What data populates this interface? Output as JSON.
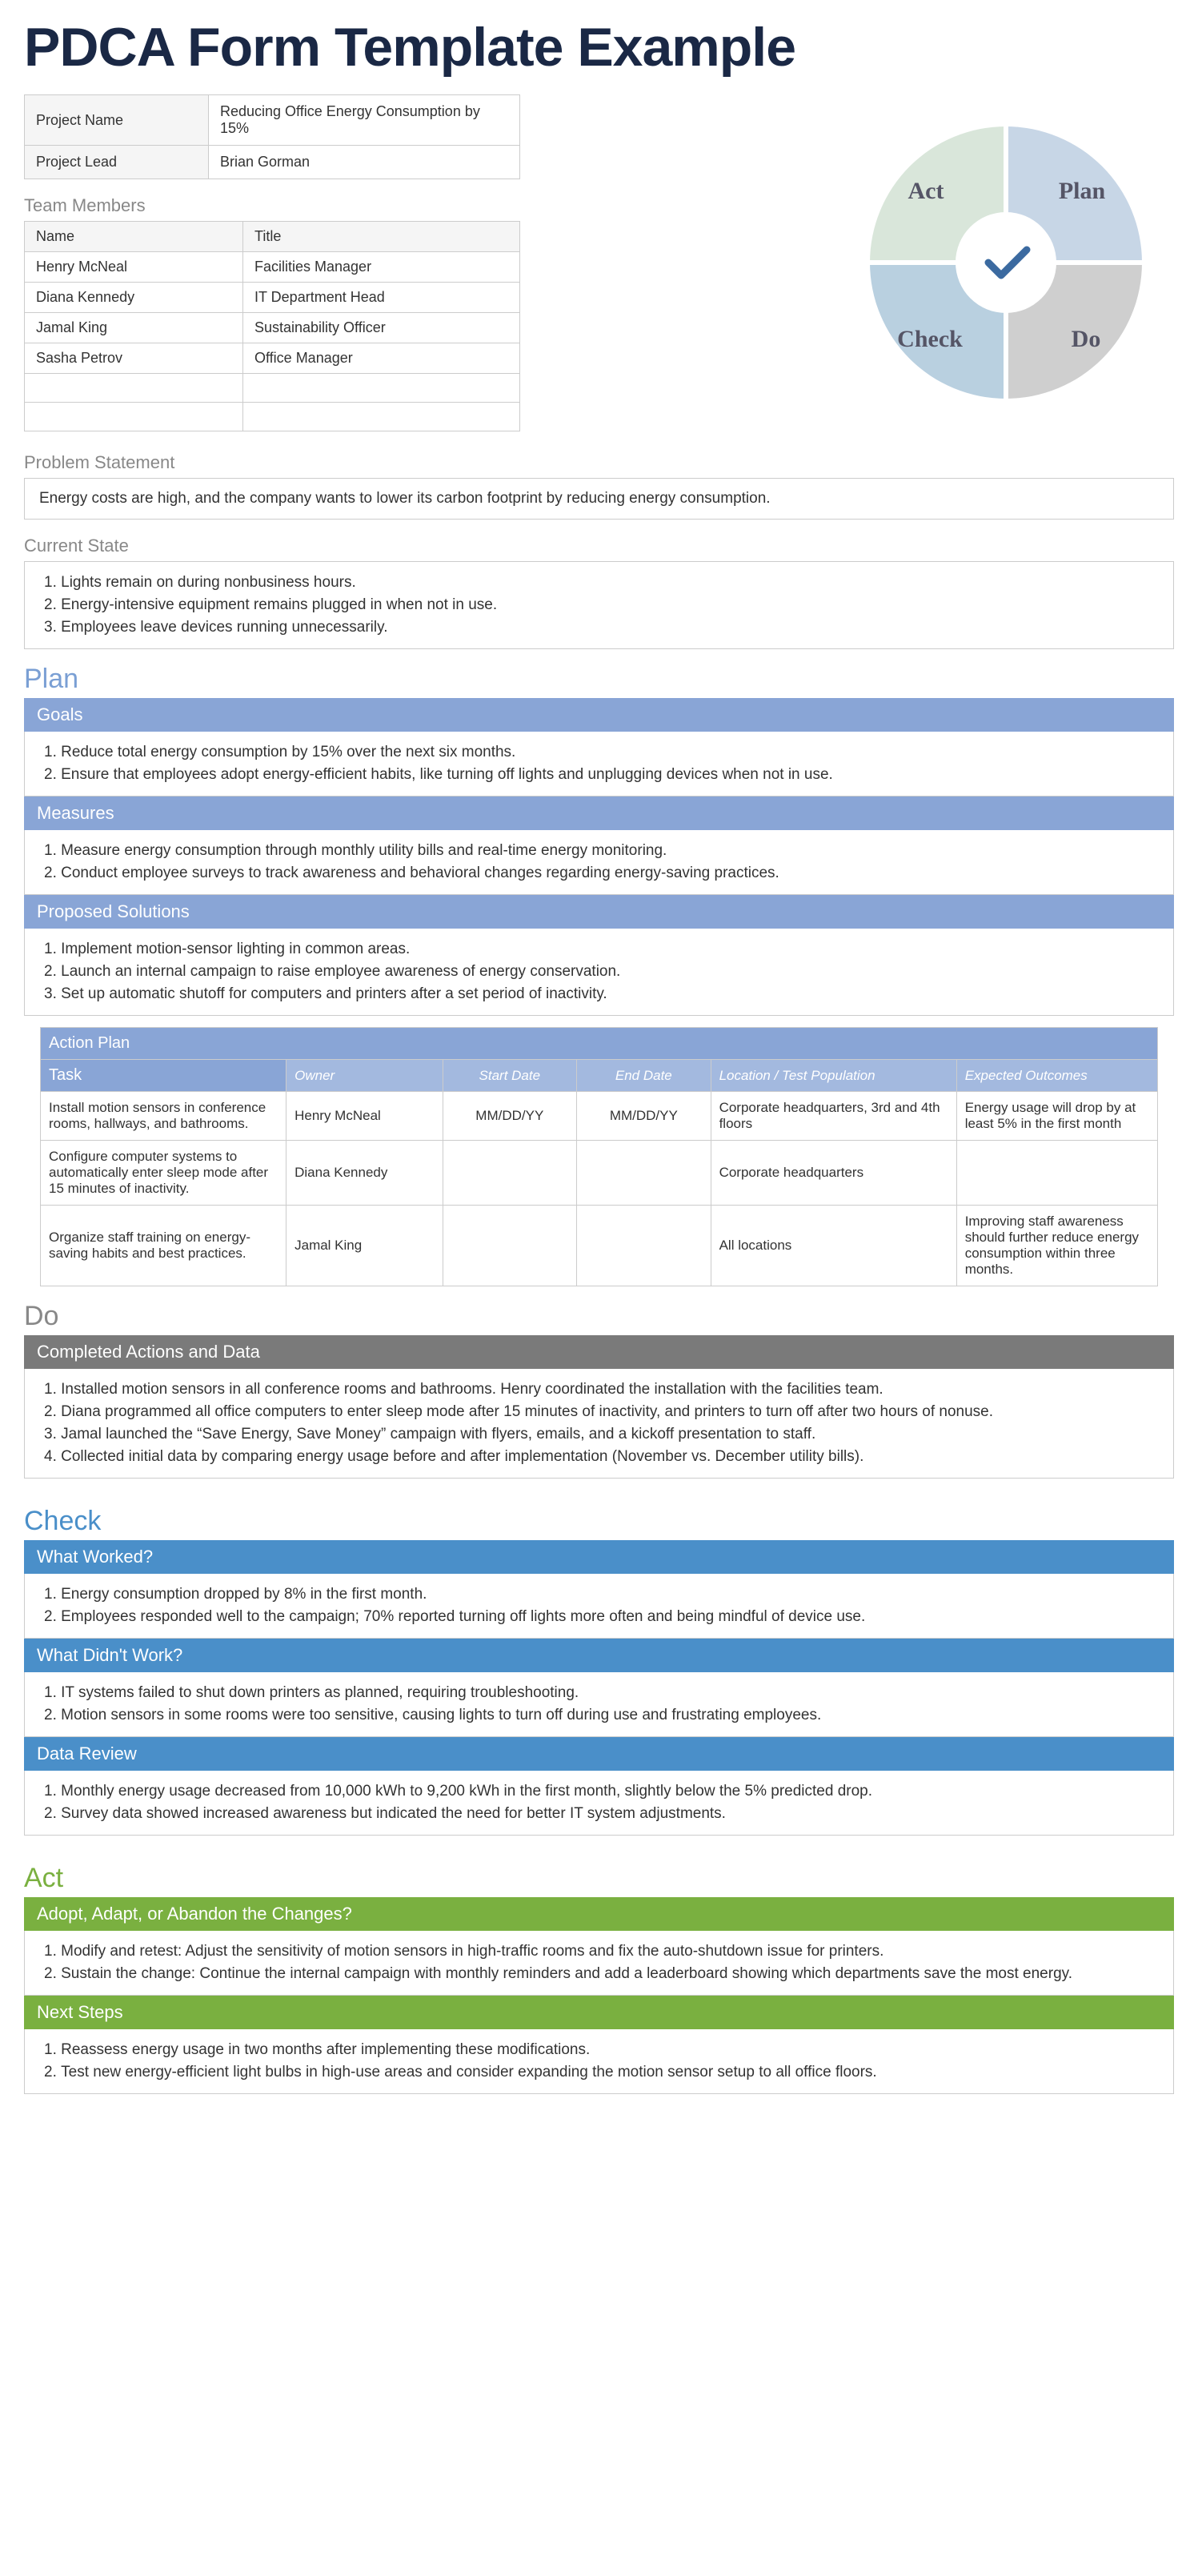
{
  "title": "PDCA Form Template Example",
  "info": {
    "projectNameLabel": "Project Name",
    "projectName": "Reducing Office Energy Consumption by 15%",
    "projectLeadLabel": "Project Lead",
    "projectLead": "Brian Gorman"
  },
  "teamMembers": {
    "label": "Team Members",
    "headers": {
      "name": "Name",
      "title": "Title"
    },
    "rows": [
      {
        "name": "Henry McNeal",
        "title": "Facilities Manager"
      },
      {
        "name": "Diana Kennedy",
        "title": "IT Department Head"
      },
      {
        "name": "Jamal King",
        "title": "Sustainability Officer"
      },
      {
        "name": "Sasha Petrov",
        "title": "Office Manager"
      }
    ]
  },
  "diagram": {
    "plan": "Plan",
    "do": "Do",
    "check": "Check",
    "act": "Act"
  },
  "problemStatement": {
    "label": "Problem Statement",
    "text": "Energy costs are high, and the company wants to lower its carbon footprint by reducing energy consumption."
  },
  "currentState": {
    "label": "Current State",
    "items": [
      "Lights remain on during nonbusiness hours.",
      "Energy-intensive equipment remains plugged in when not in use.",
      "Employees leave devices running unnecessarily."
    ]
  },
  "plan": {
    "heading": "Plan",
    "goalsLabel": "Goals",
    "goals": [
      "Reduce total energy consumption by 15% over the next six months.",
      "Ensure that employees adopt energy-efficient habits, like turning off lights and unplugging devices when not in use."
    ],
    "measuresLabel": "Measures",
    "measures": [
      "Measure energy consumption through monthly utility bills and real-time energy monitoring.",
      "Conduct employee surveys to track awareness and behavioral changes regarding energy-saving practices."
    ],
    "proposedLabel": "Proposed Solutions",
    "proposed": [
      "Implement motion-sensor lighting in common areas.",
      "Launch an internal campaign to raise employee awareness of energy conservation.",
      "Set up automatic shutoff for computers and printers after a set period of inactivity."
    ],
    "actionPlan": {
      "label": "Action Plan",
      "headers": {
        "task": "Task",
        "owner": "Owner",
        "start": "Start Date",
        "end": "End Date",
        "loc": "Location / Test Population",
        "out": "Expected Outcomes"
      },
      "rows": [
        {
          "task": "Install motion sensors in conference rooms, hallways, and bathrooms.",
          "owner": "Henry McNeal",
          "start": "MM/DD/YY",
          "end": "MM/DD/YY",
          "loc": "Corporate headquarters, 3rd and 4th floors",
          "out": "Energy usage will drop by at least 5% in the first month"
        },
        {
          "task": "Configure computer systems to automatically enter sleep mode after 15 minutes of inactivity.",
          "owner": "Diana Kennedy",
          "start": "",
          "end": "",
          "loc": "Corporate headquarters",
          "out": ""
        },
        {
          "task": "Organize staff training on energy-saving habits and best practices.",
          "owner": "Jamal King",
          "start": "",
          "end": "",
          "loc": "All locations",
          "out": "Improving staff awareness should further reduce energy consumption within three months."
        }
      ]
    }
  },
  "do": {
    "heading": "Do",
    "completedLabel": "Completed Actions and Data",
    "items": [
      "Installed motion sensors in all conference rooms and bathrooms. Henry coordinated the installation with the facilities team.",
      "Diana programmed all office computers to enter sleep mode after 15 minutes of inactivity, and printers to turn off after two hours of nonuse.",
      "Jamal launched the “Save Energy, Save Money” campaign with flyers, emails, and a kickoff presentation to staff.",
      "Collected initial data by comparing energy usage before and after implementation (November vs. December utility bills)."
    ]
  },
  "check": {
    "heading": "Check",
    "workedLabel": "What Worked?",
    "worked": [
      "Energy consumption dropped by 8% in the first month.",
      "Employees responded well to the campaign; 70% reported turning off lights more often and being mindful of device use."
    ],
    "notWorkedLabel": "What Didn't Work?",
    "notWorked": [
      "IT systems failed to shut down printers as planned, requiring troubleshooting.",
      "Motion sensors in some rooms were too sensitive, causing lights to turn off during use and frustrating employees."
    ],
    "dataReviewLabel": "Data Review",
    "dataReview": [
      "Monthly energy usage decreased from 10,000 kWh to 9,200 kWh in the first month, slightly below the 5% predicted drop.",
      "Survey data showed increased awareness but indicated the need for better IT system adjustments."
    ]
  },
  "act": {
    "heading": "Act",
    "adoptLabel": "Adopt, Adapt, or Abandon the Changes?",
    "adopt": [
      "Modify and retest: Adjust the sensitivity of motion sensors in high-traffic rooms and fix the auto-shutdown issue for printers.",
      "Sustain the change: Continue the internal campaign with monthly reminders and add a leaderboard showing which departments save the most energy."
    ],
    "nextLabel": "Next Steps",
    "next": [
      "Reassess energy usage in two months after implementing these modifications.",
      "Test new energy-efficient light bulbs in high-use areas and consider expanding the motion sensor setup to all office floors."
    ]
  }
}
